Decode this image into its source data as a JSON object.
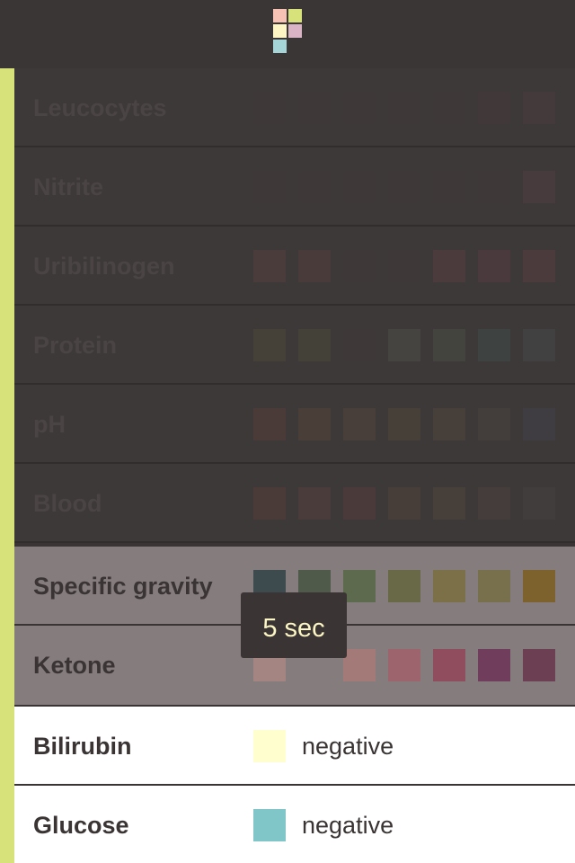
{
  "header": {
    "logo_icon": "app-logo-squares"
  },
  "colors": {
    "accent": "#d8e27a",
    "header": "#3b3636"
  },
  "tooltip": {
    "text": "5 sec"
  },
  "tests": [
    {
      "label": "Leucocytes",
      "swatches": [
        "#3e3838",
        "#3e3838",
        "#3e3838",
        "#3e3838",
        "#3e3838",
        "#413839",
        "#443a3b"
      ]
    },
    {
      "label": "Nitrite",
      "swatches": [
        "#3e3838",
        "#3e3838",
        "#3e3838",
        "#3e3838",
        "#3e3838",
        "#3f3838",
        "#473b3d"
      ]
    },
    {
      "label": "Uribilinogen",
      "swatches": [
        "#493c3a",
        "#4a3b3b",
        "#3e3838",
        "#3e3838",
        "#4b3b3c",
        "#4b3a3d",
        "#4b3b3d"
      ]
    },
    {
      "label": "Protein",
      "swatches": [
        "#454038",
        "#444139",
        "#3e3838",
        "#464440",
        "#44443e",
        "#3e4241",
        "#424142"
      ]
    },
    {
      "label": "pH",
      "swatches": [
        "#4a3b38",
        "#4a3e38",
        "#483e3a",
        "#474039",
        "#463f3a",
        "#433d3b",
        "#403d42"
      ]
    },
    {
      "label": "Blood",
      "swatches": [
        "#4a3b38",
        "#4a3c3a",
        "#4a3b3a",
        "#473e39",
        "#463f3a",
        "#453d3c",
        "#423d3d"
      ]
    },
    {
      "label": "Specific gravity",
      "swatches": [
        "#3e4b4e",
        "#4f5a4a",
        "#5e6a4e",
        "#696847",
        "#7b7048",
        "#78704c",
        "#7e622d"
      ]
    },
    {
      "label": "Ketone",
      "swatches": [
        "#a48581",
        "#857d7d",
        "#a37a77",
        "#9d646d",
        "#8f4d5e",
        "#703e5c",
        "#6c4052"
      ]
    },
    {
      "label": "Bilirubin",
      "color": "#fffecf",
      "value": "negative"
    },
    {
      "label": "Glucose",
      "color": "#80c5c8",
      "value": "negative"
    }
  ]
}
